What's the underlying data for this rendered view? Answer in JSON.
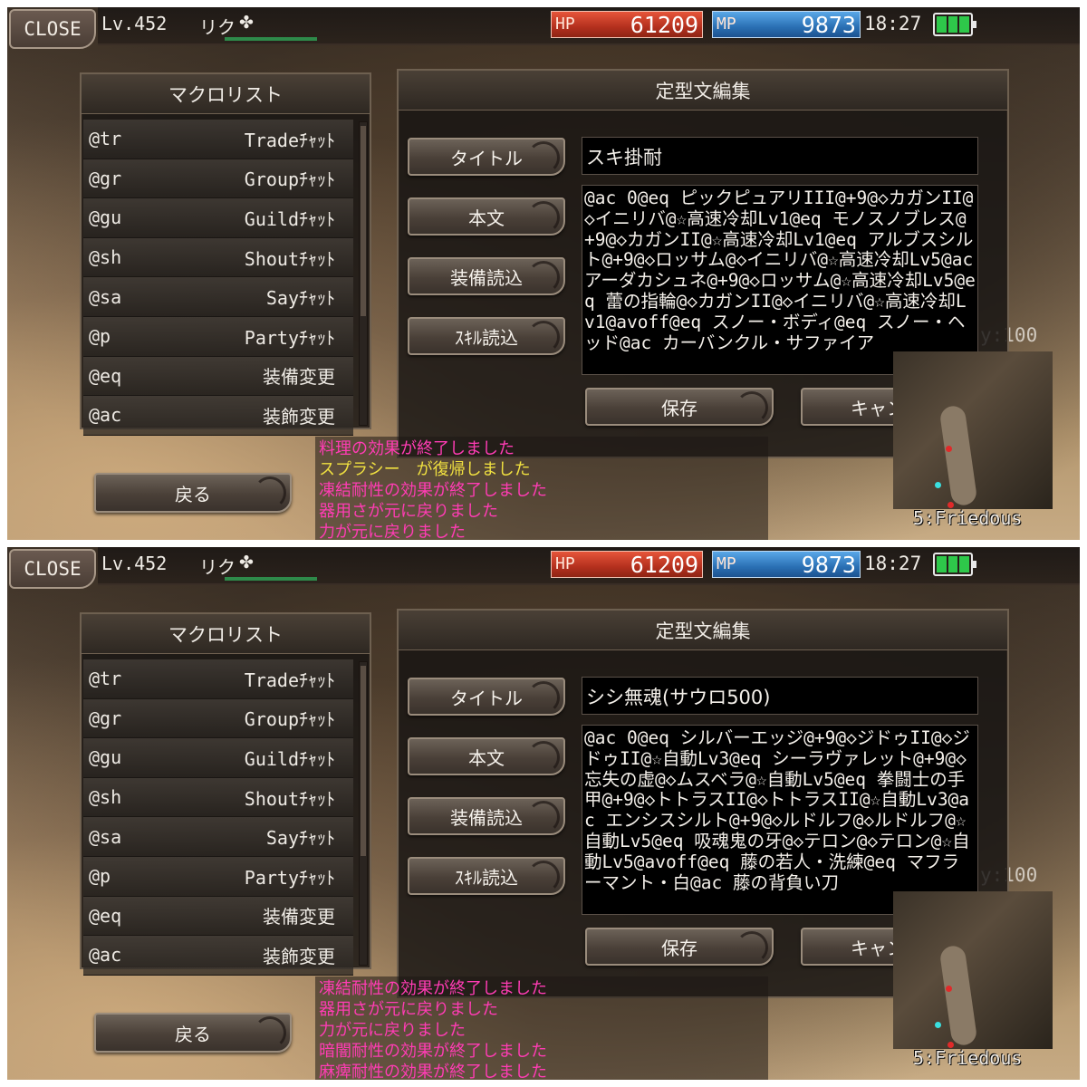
{
  "screens": [
    {
      "close_label": "CLOSE",
      "level": "Lv.452",
      "char_name": "リク",
      "clover_icon": "✤",
      "hp_label": "HP",
      "hp_value": "61209",
      "mp_label": "MP",
      "mp_value": "9873",
      "clock": "18:27",
      "macro_list": {
        "title": "マクロリスト",
        "items": [
          {
            "cmd": "@tr",
            "desc": "Tradeﾁｬｯﾄ"
          },
          {
            "cmd": "@gr",
            "desc": "Groupﾁｬｯﾄ"
          },
          {
            "cmd": "@gu",
            "desc": "Guildﾁｬｯﾄ"
          },
          {
            "cmd": "@sh",
            "desc": "Shoutﾁｬｯﾄ"
          },
          {
            "cmd": "@sa",
            "desc": "Sayﾁｬｯﾄ"
          },
          {
            "cmd": "@p",
            "desc": "Partyﾁｬｯﾄ"
          },
          {
            "cmd": "@eq",
            "desc": "装備変更"
          },
          {
            "cmd": "@ac",
            "desc": "装飾変更"
          }
        ]
      },
      "editor": {
        "title": "定型文編集",
        "title_button": "タイトル",
        "body_button": "本文",
        "equip_load_button": "装備読込",
        "skill_load_button": "ｽｷﾙ読込",
        "save_button": "保存",
        "cancel_button": "キャンセル",
        "title_value": "スキ掛耐",
        "body_value": "@ac 0@eq ピックピュアリIII@+9@◇カガンII@◇イニリバ@☆高速冷却Lv1@eq モノスノブレス@+9@◇カガンII@☆高速冷却Lv1@eq アルブスシルト@+9@◇ロッサム@◇イニリバ@☆高速冷却Lv5@ac アーダカシュネ@+9@◇ロッサム@☆高速冷却Lv5@eq 蕾の指輪@◇カガンII@◇イニリバ@☆高速冷却Lv1@avoff@eq スノー・ボディ@eq スノー・ヘッド@ac カーバンクル・サファイア"
      },
      "log": [
        {
          "text": "料理の効果が終了しました",
          "color": "pink"
        },
        {
          "text": "スプラシー　が復帰しました",
          "color": "yellow"
        },
        {
          "text": "凍結耐性の効果が終了しました",
          "color": "pink"
        },
        {
          "text": "器用さが元に戻りました",
          "color": "pink"
        },
        {
          "text": "力が元に戻りました",
          "color": "pink"
        }
      ],
      "back_button": "戻る",
      "faint_label": "y:100",
      "map_label": "5:Friedous"
    },
    {
      "close_label": "CLOSE",
      "level": "Lv.452",
      "char_name": "リク",
      "clover_icon": "✤",
      "hp_label": "HP",
      "hp_value": "61209",
      "mp_label": "MP",
      "mp_value": "9873",
      "clock": "18:27",
      "macro_list": {
        "title": "マクロリスト",
        "items": [
          {
            "cmd": "@tr",
            "desc": "Tradeﾁｬｯﾄ"
          },
          {
            "cmd": "@gr",
            "desc": "Groupﾁｬｯﾄ"
          },
          {
            "cmd": "@gu",
            "desc": "Guildﾁｬｯﾄ"
          },
          {
            "cmd": "@sh",
            "desc": "Shoutﾁｬｯﾄ"
          },
          {
            "cmd": "@sa",
            "desc": "Sayﾁｬｯﾄ"
          },
          {
            "cmd": "@p",
            "desc": "Partyﾁｬｯﾄ"
          },
          {
            "cmd": "@eq",
            "desc": "装備変更"
          },
          {
            "cmd": "@ac",
            "desc": "装飾変更"
          }
        ]
      },
      "editor": {
        "title": "定型文編集",
        "title_button": "タイトル",
        "body_button": "本文",
        "equip_load_button": "装備読込",
        "skill_load_button": "ｽｷﾙ読込",
        "save_button": "保存",
        "cancel_button": "キャンセル",
        "title_value": "シシ無魂(サウロ500)",
        "body_value": "@ac 0@eq シルバーエッジ@+9@◇ジドゥII@◇ジドゥII@☆自動Lv3@eq シーラヴァレット@+9@◇忘失の虚@◇ムスベラ@☆自動Lv5@eq 拳闘士の手甲@+9@◇トトラスII@◇トトラスII@☆自動Lv3@ac エンシスシルト@+9@◇ルドルフ@◇ルドルフ@☆自動Lv5@eq 吸魂鬼の牙@◇テロン@◇テロン@☆自動Lv5@avoff@eq 藤の若人・洗練@eq マフラーマント・白@ac 藤の背負い刀"
      },
      "log": [
        {
          "text": "凍結耐性の効果が終了しました",
          "color": "pink"
        },
        {
          "text": "器用さが元に戻りました",
          "color": "pink"
        },
        {
          "text": "力が元に戻りました",
          "color": "pink"
        },
        {
          "text": "暗闇耐性の効果が終了しました",
          "color": "pink"
        },
        {
          "text": "麻痺耐性の効果が終了しました",
          "color": "pink"
        }
      ],
      "back_button": "戻る",
      "faint_label": "y:100",
      "map_label": "5:Friedous"
    }
  ]
}
